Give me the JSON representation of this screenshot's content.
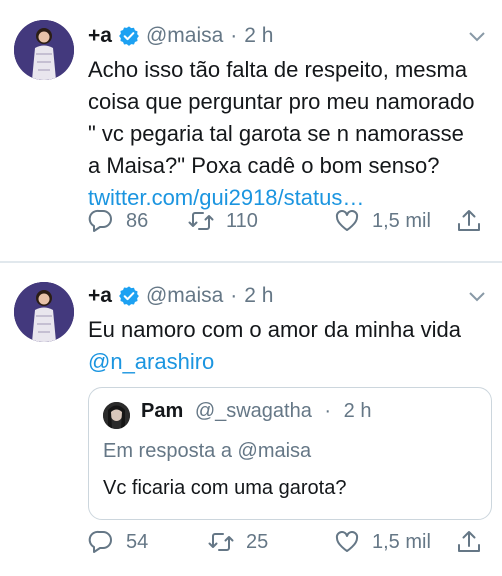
{
  "colors": {
    "link": "#1b95e0",
    "verified": "#1da1f2",
    "muted": "#657786",
    "divider": "#e1e8ed"
  },
  "tweets": [
    {
      "display_name": "+a",
      "handle": "@maisa",
      "separator": "·",
      "time": "2 h",
      "text_lines": [
        "Acho isso tão falta de respeito, mesma",
        "coisa que perguntar pro meu namorado",
        "\" vc pegaria tal garota se n namorasse",
        "a Maisa?\" Poxa cadê o bom senso?"
      ],
      "link": "twitter.com/gui2918/status…",
      "replies": "86",
      "retweets": "110",
      "likes": "1,5 mil"
    },
    {
      "display_name": "+a",
      "handle": "@maisa",
      "separator": "·",
      "time": "2 h",
      "text": "Eu namoro com o amor da minha vida",
      "mention": "@n_arashiro",
      "quoted": {
        "name": "Pam",
        "handle": "@_swagatha",
        "separator": "·",
        "time": "2 h",
        "reply_prefix": "Em resposta a",
        "reply_to": "@maisa",
        "text": "Vc ficaria com uma garota?"
      },
      "replies": "54",
      "retweets": "25",
      "likes": "1,5 mil"
    }
  ]
}
